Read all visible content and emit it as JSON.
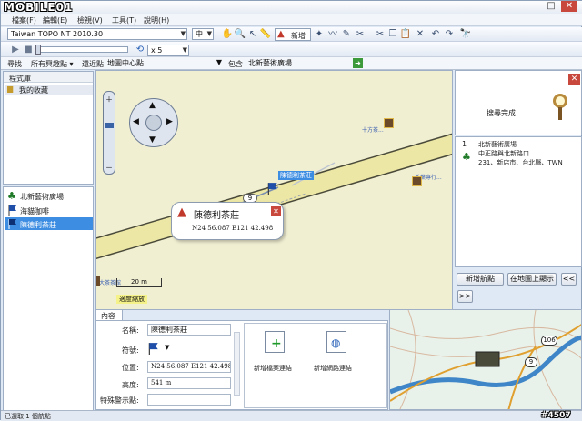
{
  "watermark": {
    "brand": "MOBILE01",
    "tag": "#4507"
  },
  "window_controls": {
    "minimize": "─",
    "maximize": "□",
    "close": "✕"
  },
  "menus": [
    "檔案(F)",
    "編輯(E)",
    "檢視(V)",
    "工具(T)",
    "說明(H)"
  ],
  "toolbar": {
    "map_product": "Taiwan TOPO NT 2010.30",
    "detail_level": "中",
    "new_label": "新增",
    "speed": "x 5"
  },
  "search_bar": {
    "find_label": "尋找",
    "category": "所有興趣點",
    "near_label": "還近點",
    "near_value": "地圖中心點",
    "contains_label": "包含",
    "query": "北新藝術廣場"
  },
  "library": {
    "header": "程式庫",
    "folder": "我的收藏"
  },
  "waypoints": [
    {
      "name": "北新藝術廣場",
      "icon": "tree"
    },
    {
      "name": "海貓咖啡",
      "icon": "flag"
    },
    {
      "name": "陳德利茶莊",
      "icon": "flag",
      "selected": true
    }
  ],
  "map": {
    "popup_title": "陳德利茶莊",
    "popup_coords": "N24 56.087 E121 42.498",
    "flag_label": "陳德利茶莊",
    "poi_right": "十方茶...",
    "poi_right2": "茶葉專行...",
    "poi_left": "大茶茶館",
    "route_shield": "9",
    "scale": "20 m",
    "zoom_hint": "適度縮放"
  },
  "results": {
    "status": "搜尋完成",
    "items": [
      {
        "index": "1",
        "name": "北新藝術廣場",
        "line2": "中正路與北新路口",
        "line3": "231、新店市、台北縣、TWN"
      }
    ],
    "add_waypoint_btn": "新增航點",
    "show_on_map_btn": "在地圖上顯示",
    "prev_btn": "<<",
    "next_btn": ">>"
  },
  "properties": {
    "tab": "內容",
    "name_label": "名稱:",
    "name_value": "陳德利茶莊",
    "symbol_label": "符號:",
    "position_label": "位置:",
    "position_value": "N24 56.087 E121 42.498",
    "altitude_label": "高度:",
    "altitude_value": "541 m",
    "proximity_label": "特殊警示點:",
    "add_file_link": "新增檔案連結",
    "add_web_link": "新增網路連結"
  },
  "minimap": {
    "shield1": "106",
    "shield2": "9"
  },
  "statusbar": {
    "text": "已選取 1 個航點"
  },
  "colors": {
    "road": "#ede7a6",
    "road_edge": "#4a4a3a",
    "selection": "#3d8ee3",
    "terrain": "#e9f2ea",
    "river": "#3f86c8"
  }
}
